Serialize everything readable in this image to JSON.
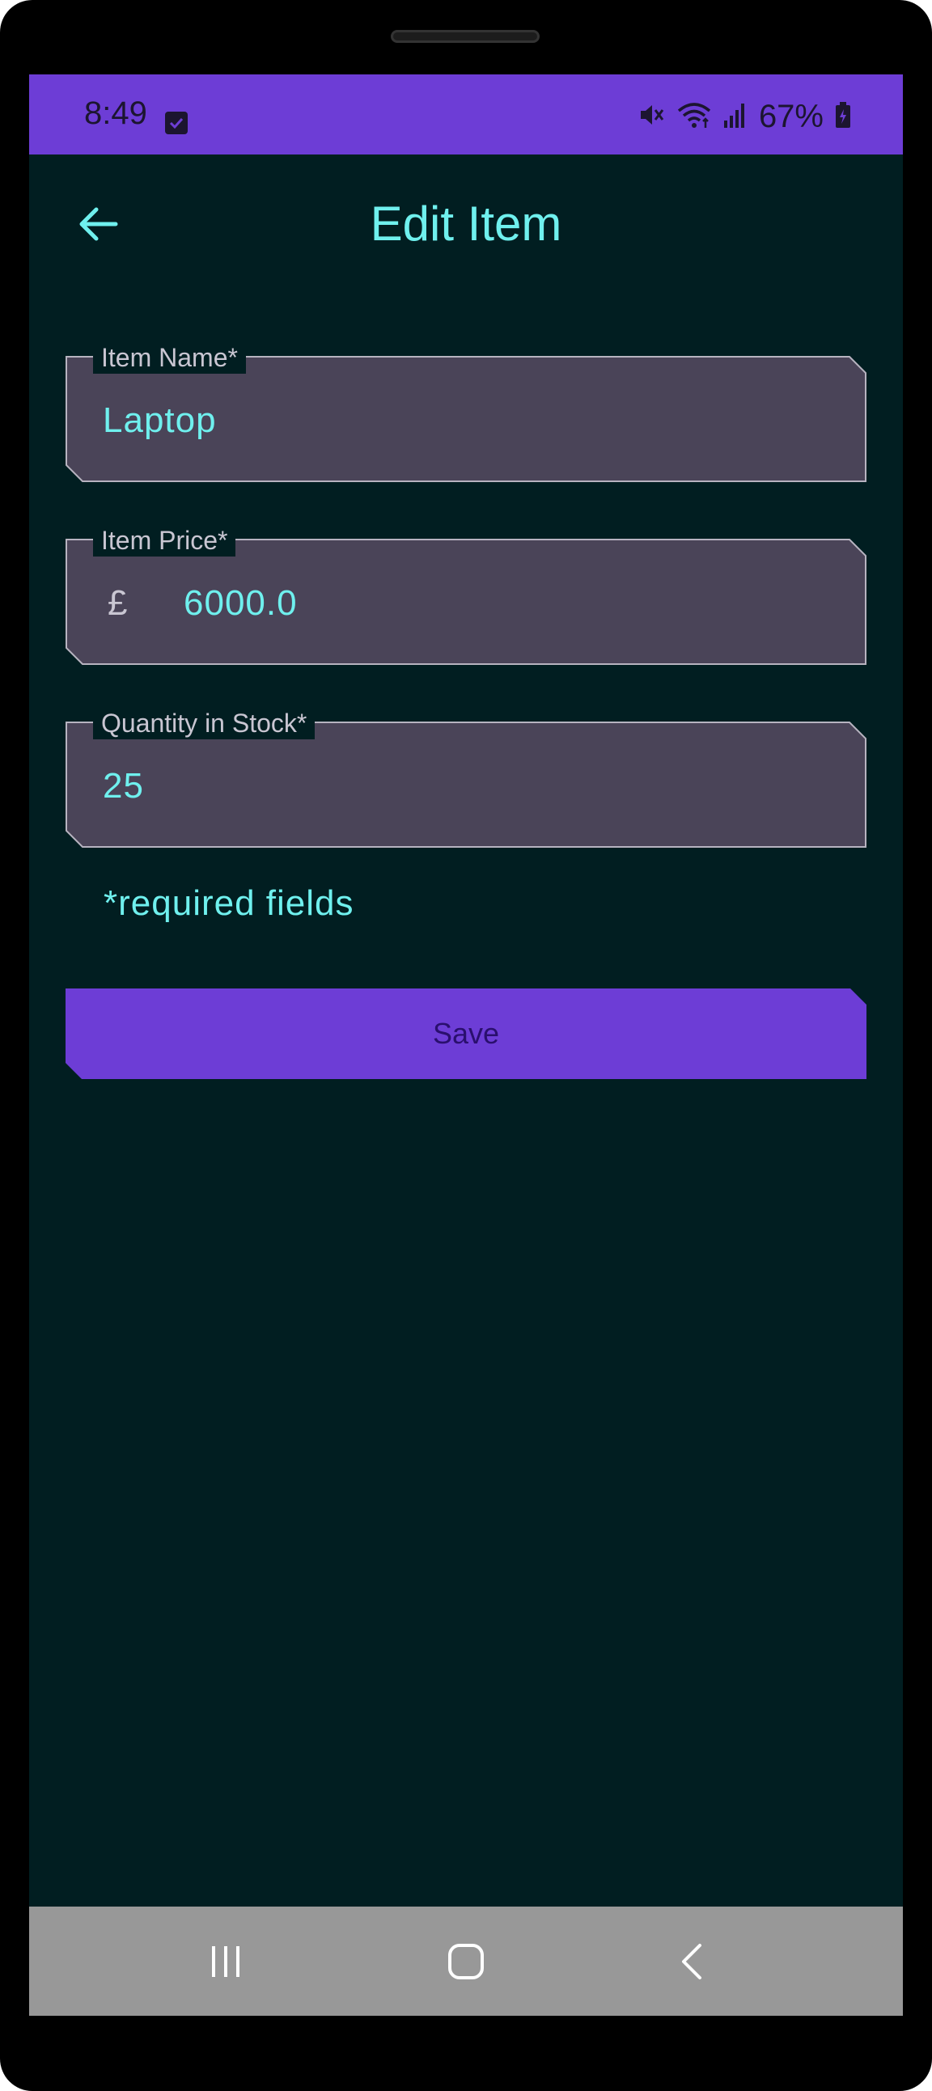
{
  "status_bar": {
    "time": "8:49",
    "battery_percent": "67%",
    "icons": [
      "checkbox-notification-icon",
      "mute-icon",
      "wifi-icon",
      "signal-icon",
      "battery-icon"
    ]
  },
  "header": {
    "title": "Edit Item",
    "back_icon": "arrow-left-icon"
  },
  "form": {
    "item_name": {
      "label": "Item Name*",
      "value": "Laptop"
    },
    "item_price": {
      "label": "Item Price*",
      "prefix": "£",
      "value": "6000.0"
    },
    "quantity": {
      "label": "Quantity in Stock*",
      "value": "25"
    },
    "required_note": "*required fields",
    "save_label": "Save"
  },
  "nav_bar": {
    "icons": [
      "recent-apps-icon",
      "home-icon",
      "back-icon"
    ]
  },
  "colors": {
    "accent": "#6d3dd6",
    "background": "#011e21",
    "field_fill": "#4a4458",
    "text_accent": "#6ff0ee"
  }
}
